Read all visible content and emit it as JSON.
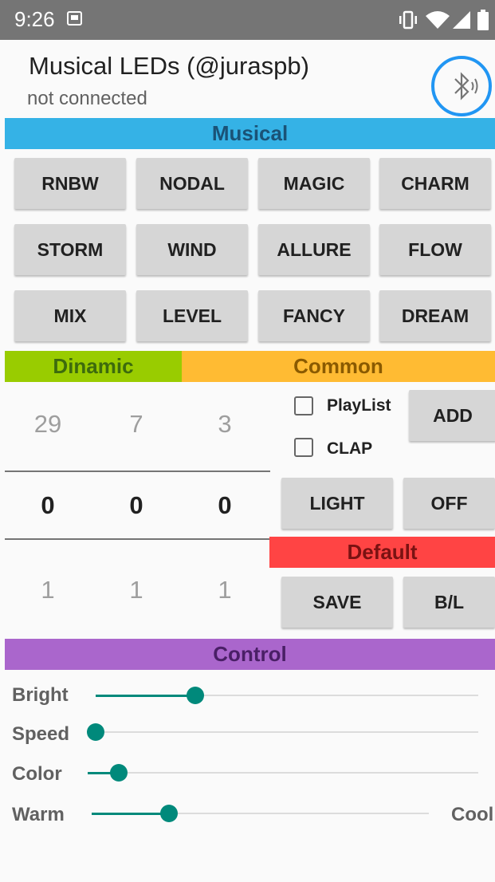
{
  "status_bar": {
    "time": "9:26"
  },
  "header": {
    "title": "Musical LEDs (@juraspb)",
    "subtitle": "not connected"
  },
  "sections": {
    "musical": "Musical",
    "dinamic": "Dinamic",
    "common": "Common",
    "default": "Default",
    "control": "Control"
  },
  "colors": {
    "musical": "#35b2e6",
    "dinamic": "#99cc00",
    "common": "#ffbb33",
    "default": "#ff4444",
    "control": "#aa66cc",
    "accent": "#00897b",
    "bluetooth": "#2196f3"
  },
  "musical_modes": [
    "RNBW",
    "NODAL",
    "MAGIC",
    "CHARM",
    "STORM",
    "WIND",
    "ALLURE",
    "FLOW",
    "MIX",
    "LEVEL",
    "FANCY",
    "DREAM"
  ],
  "pickers": {
    "above": [
      "29",
      "7",
      "3"
    ],
    "selected": [
      "0",
      "0",
      "0"
    ],
    "below": [
      "1",
      "1",
      "1"
    ]
  },
  "common": {
    "playlist_label": "PlayList",
    "clap_label": "CLAP",
    "add_label": "ADD",
    "light_label": "LIGHT",
    "off_label": "OFF",
    "save_label": "SAVE",
    "bl_label": "B/L"
  },
  "control": {
    "bright_label": "Bright",
    "bright_value": 0.26,
    "speed_label": "Speed",
    "speed_value": 0.0,
    "color_label": "Color",
    "color_value": 0.08,
    "warm_label": "Warm",
    "cool_label": "Cool",
    "warmcool_value": 0.23
  },
  "icons": {
    "notification": "notification-icon",
    "vibrate": "vibrate-icon",
    "wifi": "wifi-icon",
    "signal": "signal-icon",
    "battery": "battery-icon",
    "bluetooth": "bluetooth-icon"
  }
}
